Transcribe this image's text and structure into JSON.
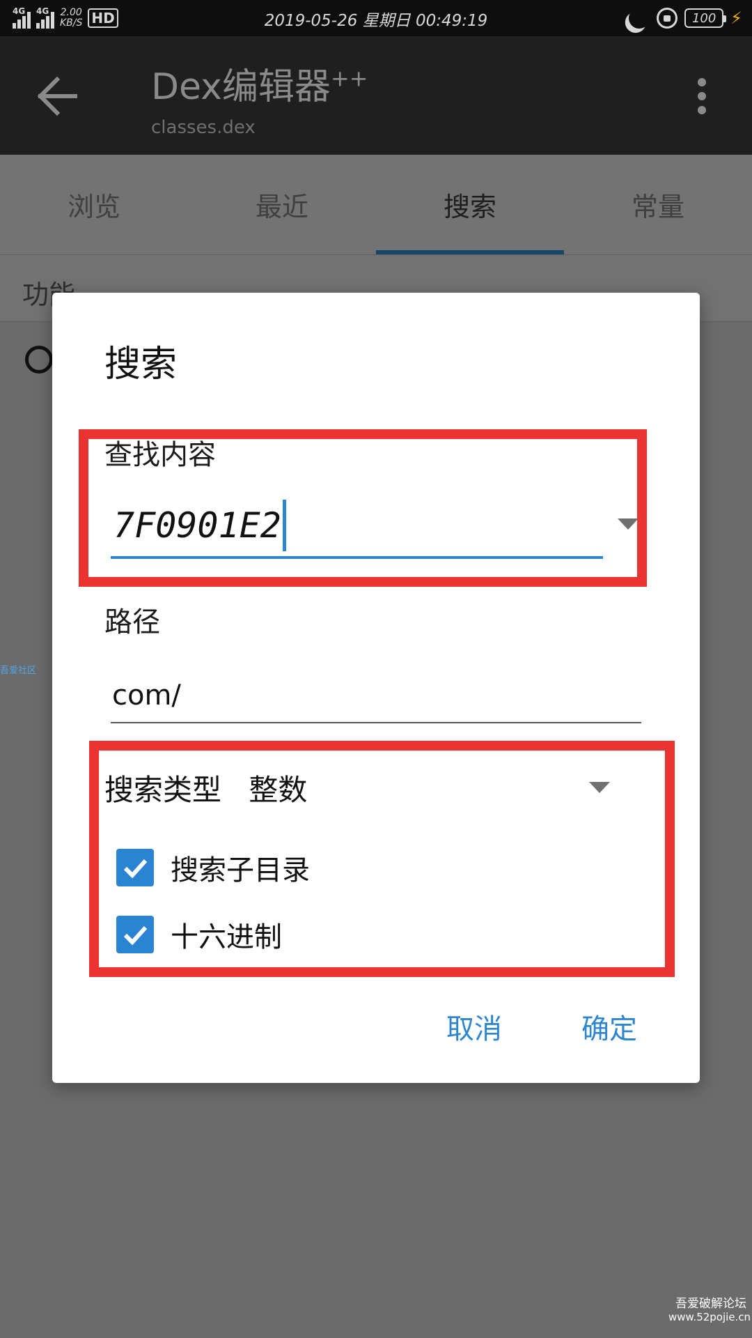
{
  "status_bar": {
    "network_1": "4G",
    "network_2": "4G",
    "speed_value": "2.00",
    "speed_unit": "KB/S",
    "hd_label": "HD",
    "datetime": "2019-05-26 星期日 00:49:19",
    "battery": "100"
  },
  "app_bar": {
    "title": "Dex编辑器",
    "title_suffix": "++",
    "subtitle": "classes.dex"
  },
  "tabs": [
    {
      "label": "浏览"
    },
    {
      "label": "最近"
    },
    {
      "label": "搜索"
    },
    {
      "label": "常量"
    }
  ],
  "background": {
    "section_label": "功能",
    "side_watermark": "吾爱社区"
  },
  "dialog": {
    "title": "搜索",
    "find_label": "查找内容",
    "find_value": "7F0901E2",
    "path_label": "路径",
    "path_value": "com/",
    "search_type_label": "搜索类型",
    "search_type_value": "整数",
    "checkboxes": [
      {
        "label": "搜索子目录",
        "checked": true
      },
      {
        "label": "十六进制",
        "checked": true
      }
    ],
    "cancel_label": "取消",
    "ok_label": "确定"
  },
  "watermark": {
    "line1": "吾爱破解论坛",
    "line2": "www.52pojie.cn"
  },
  "colors": {
    "accent": "#2f86d0",
    "highlight": "#ea3434",
    "checkbox": "#2a84d2"
  }
}
